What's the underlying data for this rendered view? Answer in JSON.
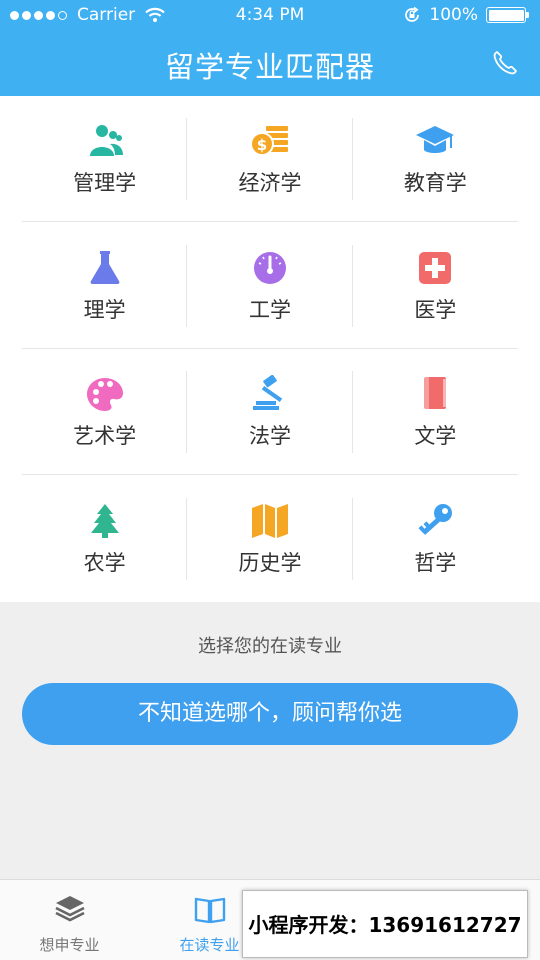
{
  "status_bar": {
    "carrier": "Carrier",
    "time": "4:34 PM",
    "battery": "100%"
  },
  "header": {
    "title": "留学专业匹配器",
    "phone_icon": "phone-icon"
  },
  "colors": {
    "accent": "#3fb0f2",
    "button": "#3fa0f0"
  },
  "categories": [
    {
      "label": "管理学",
      "icon": "people-icon",
      "color": "#26b6a2"
    },
    {
      "label": "经济学",
      "icon": "coins-icon",
      "color": "#f5a623"
    },
    {
      "label": "教育学",
      "icon": "graduation-cap-icon",
      "color": "#3fa0f0"
    },
    {
      "label": "理学",
      "icon": "flask-icon",
      "color": "#6b7bea"
    },
    {
      "label": "工学",
      "icon": "gauge-icon",
      "color": "#a86ee8"
    },
    {
      "label": "医学",
      "icon": "medical-cross-icon",
      "color": "#f26b6b"
    },
    {
      "label": "艺术学",
      "icon": "palette-icon",
      "color": "#f06ac0"
    },
    {
      "label": "法学",
      "icon": "gavel-icon",
      "color": "#3fa0f0"
    },
    {
      "label": "文学",
      "icon": "book-icon",
      "color": "#f26b6b"
    },
    {
      "label": "农学",
      "icon": "tree-icon",
      "color": "#2fb590"
    },
    {
      "label": "历史学",
      "icon": "map-icon",
      "color": "#f5a623"
    },
    {
      "label": "哲学",
      "icon": "key-icon",
      "color": "#3fa0f0"
    }
  ],
  "hint": "选择您的在读专业",
  "cta_label": "不知道选哪个，顾问帮你选",
  "tabs": [
    {
      "label": "想申专业",
      "icon": "layers-icon",
      "active": false
    },
    {
      "label": "在读专业",
      "icon": "open-book-icon",
      "active": true
    }
  ],
  "promo_text": "小程序开发：13691612727"
}
